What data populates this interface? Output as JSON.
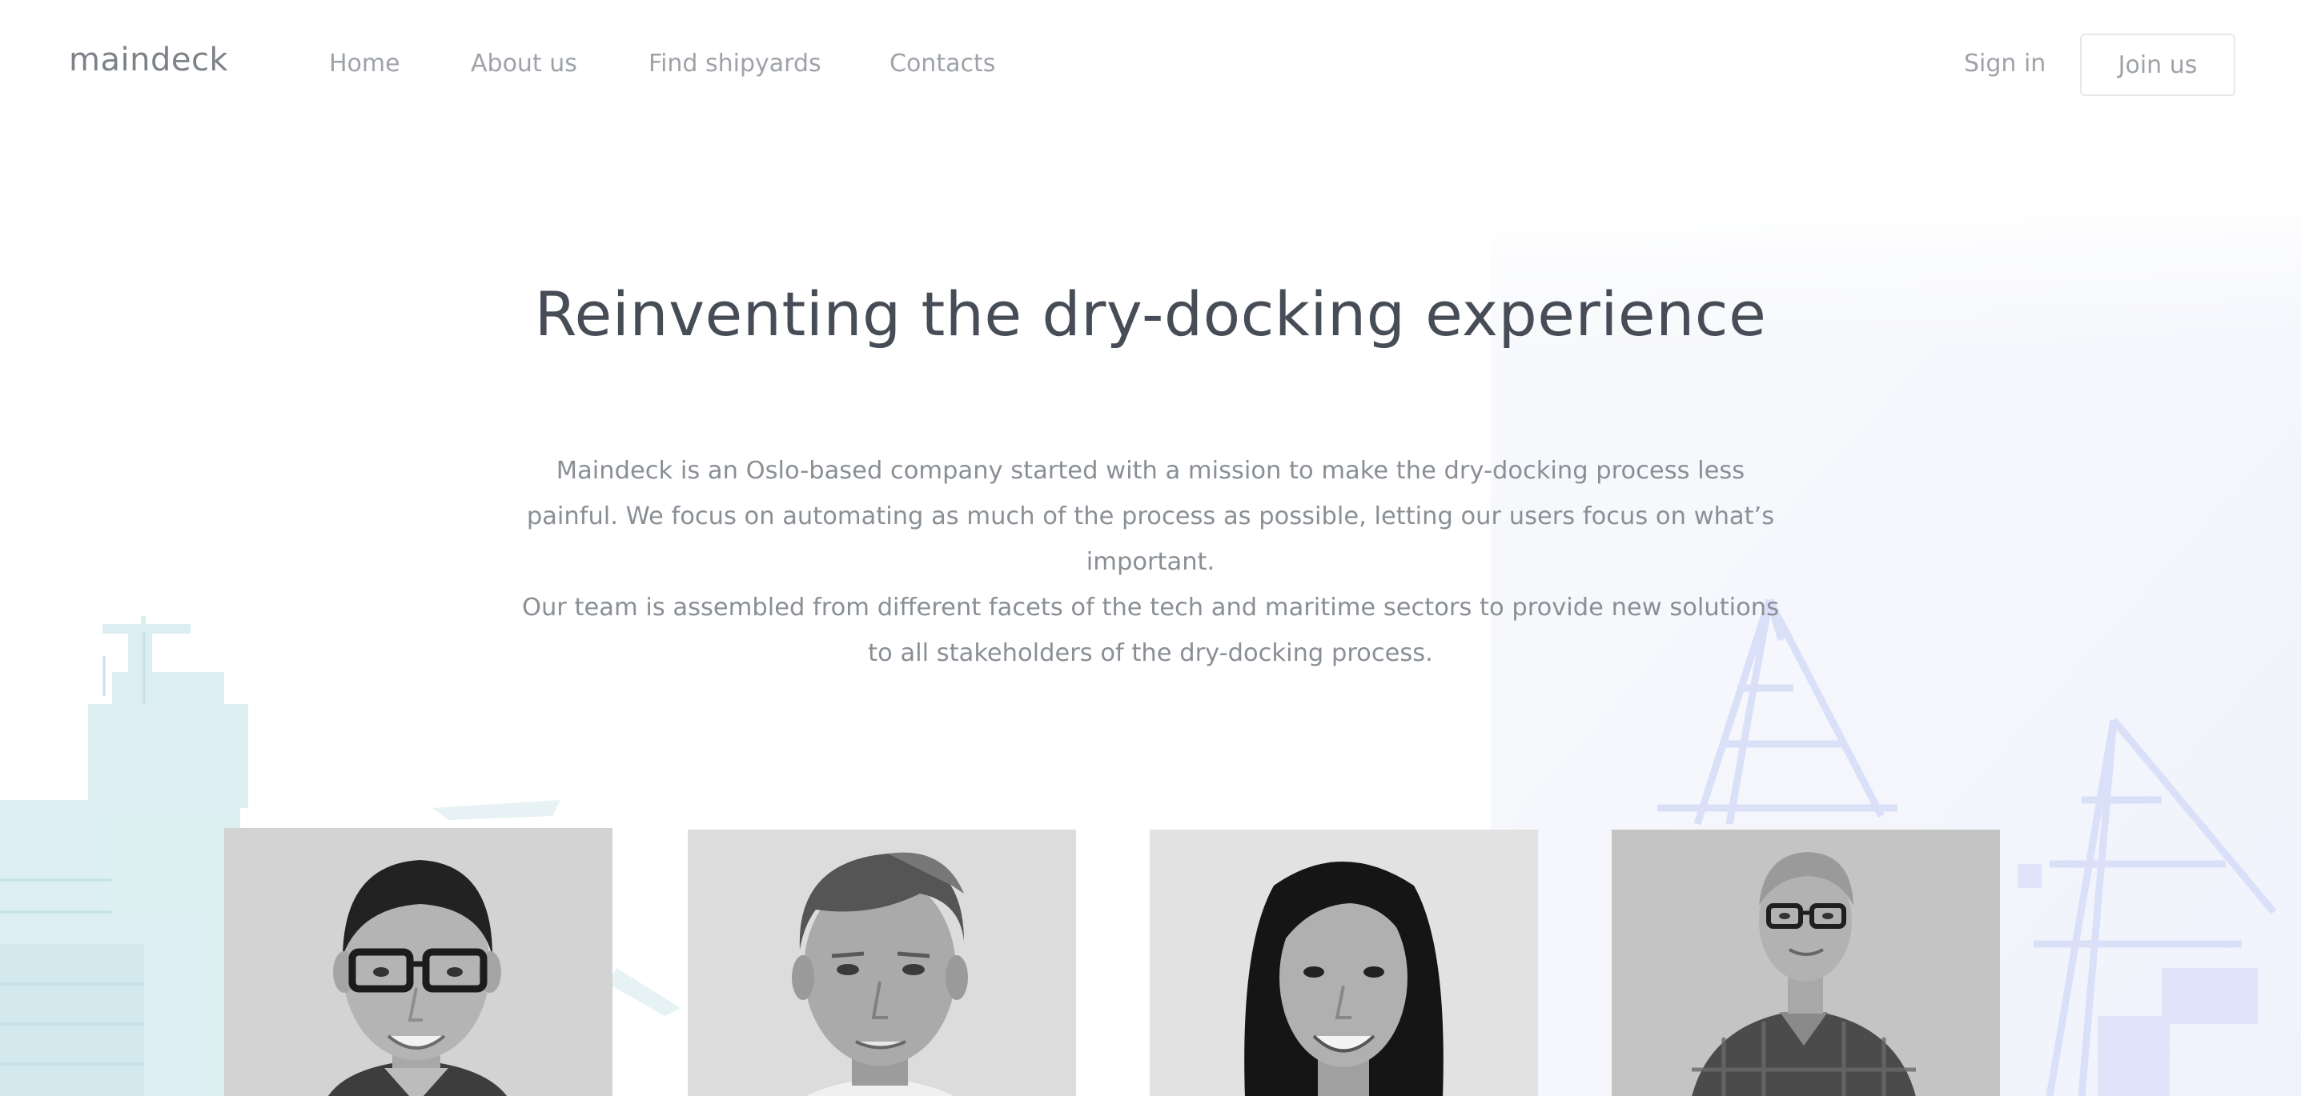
{
  "nav": {
    "logo": "maindeck",
    "links": [
      {
        "label": "Home"
      },
      {
        "label": "About us"
      },
      {
        "label": "Find shipyards"
      },
      {
        "label": "Contacts"
      }
    ],
    "sign_in": "Sign in",
    "join": "Join us"
  },
  "hero": {
    "title": "Reinventing the dry-docking experience",
    "paragraphs": [
      "Maindeck is an Oslo-based company started with a mission to make the dry-docking process less painful. We focus on automating as much of the process as possible, letting our users focus on what’s important.",
      "Our team is assembled from different facets of the tech and maritime sectors to provide new solutions to all stakeholders of the dry-docking process."
    ]
  },
  "colors": {
    "heading": "#474d57",
    "body_text": "#8a8f95",
    "nav_text": "#9fa3a8",
    "logo": "#7d8288",
    "button_border": "#e6e8eb",
    "ship_tint": "#d6ecef",
    "crane_tint": "#dfe4fa"
  },
  "icons": {
    "background": "harbor-ship-and-cranes-illustration",
    "team_photos": [
      "team-member-1-photo",
      "team-member-2-photo",
      "team-member-3-photo",
      "team-member-4-photo"
    ]
  }
}
